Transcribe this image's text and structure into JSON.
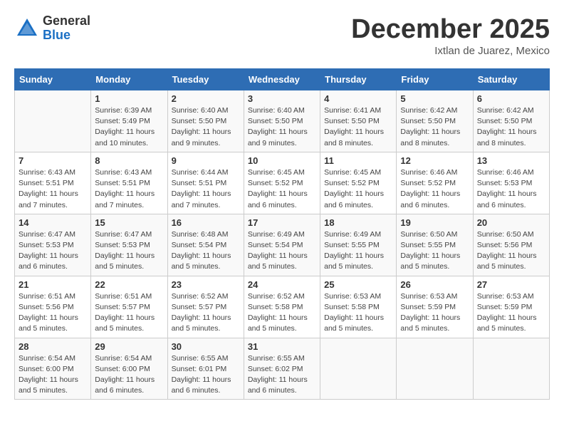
{
  "header": {
    "logo_general": "General",
    "logo_blue": "Blue",
    "month_title": "December 2025",
    "location": "Ixtlan de Juarez, Mexico"
  },
  "days_of_week": [
    "Sunday",
    "Monday",
    "Tuesday",
    "Wednesday",
    "Thursday",
    "Friday",
    "Saturday"
  ],
  "weeks": [
    [
      {
        "day": "",
        "info": ""
      },
      {
        "day": "1",
        "info": "Sunrise: 6:39 AM\nSunset: 5:49 PM\nDaylight: 11 hours\nand 10 minutes."
      },
      {
        "day": "2",
        "info": "Sunrise: 6:40 AM\nSunset: 5:50 PM\nDaylight: 11 hours\nand 9 minutes."
      },
      {
        "day": "3",
        "info": "Sunrise: 6:40 AM\nSunset: 5:50 PM\nDaylight: 11 hours\nand 9 minutes."
      },
      {
        "day": "4",
        "info": "Sunrise: 6:41 AM\nSunset: 5:50 PM\nDaylight: 11 hours\nand 8 minutes."
      },
      {
        "day": "5",
        "info": "Sunrise: 6:42 AM\nSunset: 5:50 PM\nDaylight: 11 hours\nand 8 minutes."
      },
      {
        "day": "6",
        "info": "Sunrise: 6:42 AM\nSunset: 5:50 PM\nDaylight: 11 hours\nand 8 minutes."
      }
    ],
    [
      {
        "day": "7",
        "info": "Sunrise: 6:43 AM\nSunset: 5:51 PM\nDaylight: 11 hours\nand 7 minutes."
      },
      {
        "day": "8",
        "info": "Sunrise: 6:43 AM\nSunset: 5:51 PM\nDaylight: 11 hours\nand 7 minutes."
      },
      {
        "day": "9",
        "info": "Sunrise: 6:44 AM\nSunset: 5:51 PM\nDaylight: 11 hours\nand 7 minutes."
      },
      {
        "day": "10",
        "info": "Sunrise: 6:45 AM\nSunset: 5:52 PM\nDaylight: 11 hours\nand 6 minutes."
      },
      {
        "day": "11",
        "info": "Sunrise: 6:45 AM\nSunset: 5:52 PM\nDaylight: 11 hours\nand 6 minutes."
      },
      {
        "day": "12",
        "info": "Sunrise: 6:46 AM\nSunset: 5:52 PM\nDaylight: 11 hours\nand 6 minutes."
      },
      {
        "day": "13",
        "info": "Sunrise: 6:46 AM\nSunset: 5:53 PM\nDaylight: 11 hours\nand 6 minutes."
      }
    ],
    [
      {
        "day": "14",
        "info": "Sunrise: 6:47 AM\nSunset: 5:53 PM\nDaylight: 11 hours\nand 6 minutes."
      },
      {
        "day": "15",
        "info": "Sunrise: 6:47 AM\nSunset: 5:53 PM\nDaylight: 11 hours\nand 5 minutes."
      },
      {
        "day": "16",
        "info": "Sunrise: 6:48 AM\nSunset: 5:54 PM\nDaylight: 11 hours\nand 5 minutes."
      },
      {
        "day": "17",
        "info": "Sunrise: 6:49 AM\nSunset: 5:54 PM\nDaylight: 11 hours\nand 5 minutes."
      },
      {
        "day": "18",
        "info": "Sunrise: 6:49 AM\nSunset: 5:55 PM\nDaylight: 11 hours\nand 5 minutes."
      },
      {
        "day": "19",
        "info": "Sunrise: 6:50 AM\nSunset: 5:55 PM\nDaylight: 11 hours\nand 5 minutes."
      },
      {
        "day": "20",
        "info": "Sunrise: 6:50 AM\nSunset: 5:56 PM\nDaylight: 11 hours\nand 5 minutes."
      }
    ],
    [
      {
        "day": "21",
        "info": "Sunrise: 6:51 AM\nSunset: 5:56 PM\nDaylight: 11 hours\nand 5 minutes."
      },
      {
        "day": "22",
        "info": "Sunrise: 6:51 AM\nSunset: 5:57 PM\nDaylight: 11 hours\nand 5 minutes."
      },
      {
        "day": "23",
        "info": "Sunrise: 6:52 AM\nSunset: 5:57 PM\nDaylight: 11 hours\nand 5 minutes."
      },
      {
        "day": "24",
        "info": "Sunrise: 6:52 AM\nSunset: 5:58 PM\nDaylight: 11 hours\nand 5 minutes."
      },
      {
        "day": "25",
        "info": "Sunrise: 6:53 AM\nSunset: 5:58 PM\nDaylight: 11 hours\nand 5 minutes."
      },
      {
        "day": "26",
        "info": "Sunrise: 6:53 AM\nSunset: 5:59 PM\nDaylight: 11 hours\nand 5 minutes."
      },
      {
        "day": "27",
        "info": "Sunrise: 6:53 AM\nSunset: 5:59 PM\nDaylight: 11 hours\nand 5 minutes."
      }
    ],
    [
      {
        "day": "28",
        "info": "Sunrise: 6:54 AM\nSunset: 6:00 PM\nDaylight: 11 hours\nand 5 minutes."
      },
      {
        "day": "29",
        "info": "Sunrise: 6:54 AM\nSunset: 6:00 PM\nDaylight: 11 hours\nand 6 minutes."
      },
      {
        "day": "30",
        "info": "Sunrise: 6:55 AM\nSunset: 6:01 PM\nDaylight: 11 hours\nand 6 minutes."
      },
      {
        "day": "31",
        "info": "Sunrise: 6:55 AM\nSunset: 6:02 PM\nDaylight: 11 hours\nand 6 minutes."
      },
      {
        "day": "",
        "info": ""
      },
      {
        "day": "",
        "info": ""
      },
      {
        "day": "",
        "info": ""
      }
    ]
  ]
}
